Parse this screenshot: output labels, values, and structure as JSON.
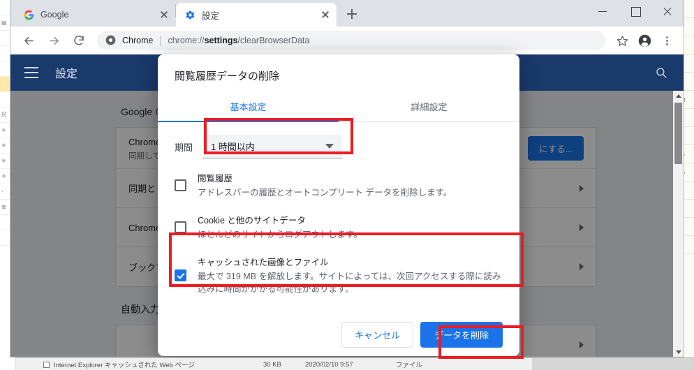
{
  "browser": {
    "tabs": [
      {
        "title": "Google",
        "favicon": "google-icon",
        "active": false
      },
      {
        "title": "設定",
        "favicon": "settings-gear-icon",
        "active": true
      }
    ],
    "new_tab_label": "+",
    "window_controls": {
      "minimize": "minimize-icon",
      "maximize": "maximize-icon",
      "close": "close-icon"
    },
    "toolbar": {
      "back": "back-arrow-icon",
      "forward": "forward-arrow-icon",
      "reload": "reload-icon",
      "scheme_label": "Chrome",
      "url_prefix": "chrome://",
      "url_bold": "settings",
      "url_suffix": "/clearBrowserData",
      "url_full": "chrome://settings/clearBrowserData",
      "bookmark": "star-icon",
      "profile": "account-avatar-icon",
      "menu": "three-dot-menu-icon"
    }
  },
  "settings_page": {
    "topbar": {
      "menu_icon": "hamburger-menu-icon",
      "title": "設定",
      "search_icon": "search-icon"
    },
    "section_title": "Google の設定",
    "rows": [
      {
        "title": "Chrome で",
        "subtitle": "同期して力",
        "action_label": "にする...",
        "action_type": "button"
      },
      {
        "title": "同期と Goo",
        "subtitle": "",
        "action_type": "chevron"
      },
      {
        "title": "Chrome の",
        "subtitle": "",
        "action_type": "chevron"
      },
      {
        "title": "ブックマー",
        "subtitle": "",
        "action_type": "chevron"
      }
    ],
    "autofill_title": "自動入力",
    "scrollbar": {
      "up": "scroll-up-arrow",
      "down": "scroll-down-arrow"
    }
  },
  "dialog": {
    "title": "閲覧履歴データの削除",
    "tabs": [
      {
        "label": "基本設定",
        "active": true
      },
      {
        "label": "詳細設定",
        "active": false
      }
    ],
    "time_range": {
      "label": "期間",
      "value": "1 時間以内"
    },
    "options": [
      {
        "title": "閲覧履歴",
        "description": "アドレスバーの履歴とオートコンプリート データを削除します。",
        "checked": false
      },
      {
        "title": "Cookie と他のサイトデータ",
        "description": "ほとんどのサイトからログアウトします。",
        "checked": false
      },
      {
        "title": "キャッシュされた画像とファイル",
        "description": "最大で 319 MB を解放します。サイトによっては、次回アクセスする際に読み込みに時間がかかる可能性があります。",
        "checked": true
      }
    ],
    "cancel_label": "キャンセル",
    "confirm_label": "データを削除"
  },
  "annotations": {
    "accent_color": "#ec1c24",
    "boxes": [
      "time-range-dropdown",
      "cached-images-option",
      "delete-data-button"
    ]
  },
  "background_window": {
    "row": {
      "name": "Internet Explorer キャッシュされた Web ページ",
      "size": "30 KB",
      "date": "2020/02/10 9:57",
      "type": "ファイル"
    }
  },
  "colors": {
    "chrome_blue": "#1a73e8",
    "settings_bar": "#1a3a6b",
    "annotation_red": "#ec1c24",
    "tabstrip": "#dee1e6"
  }
}
